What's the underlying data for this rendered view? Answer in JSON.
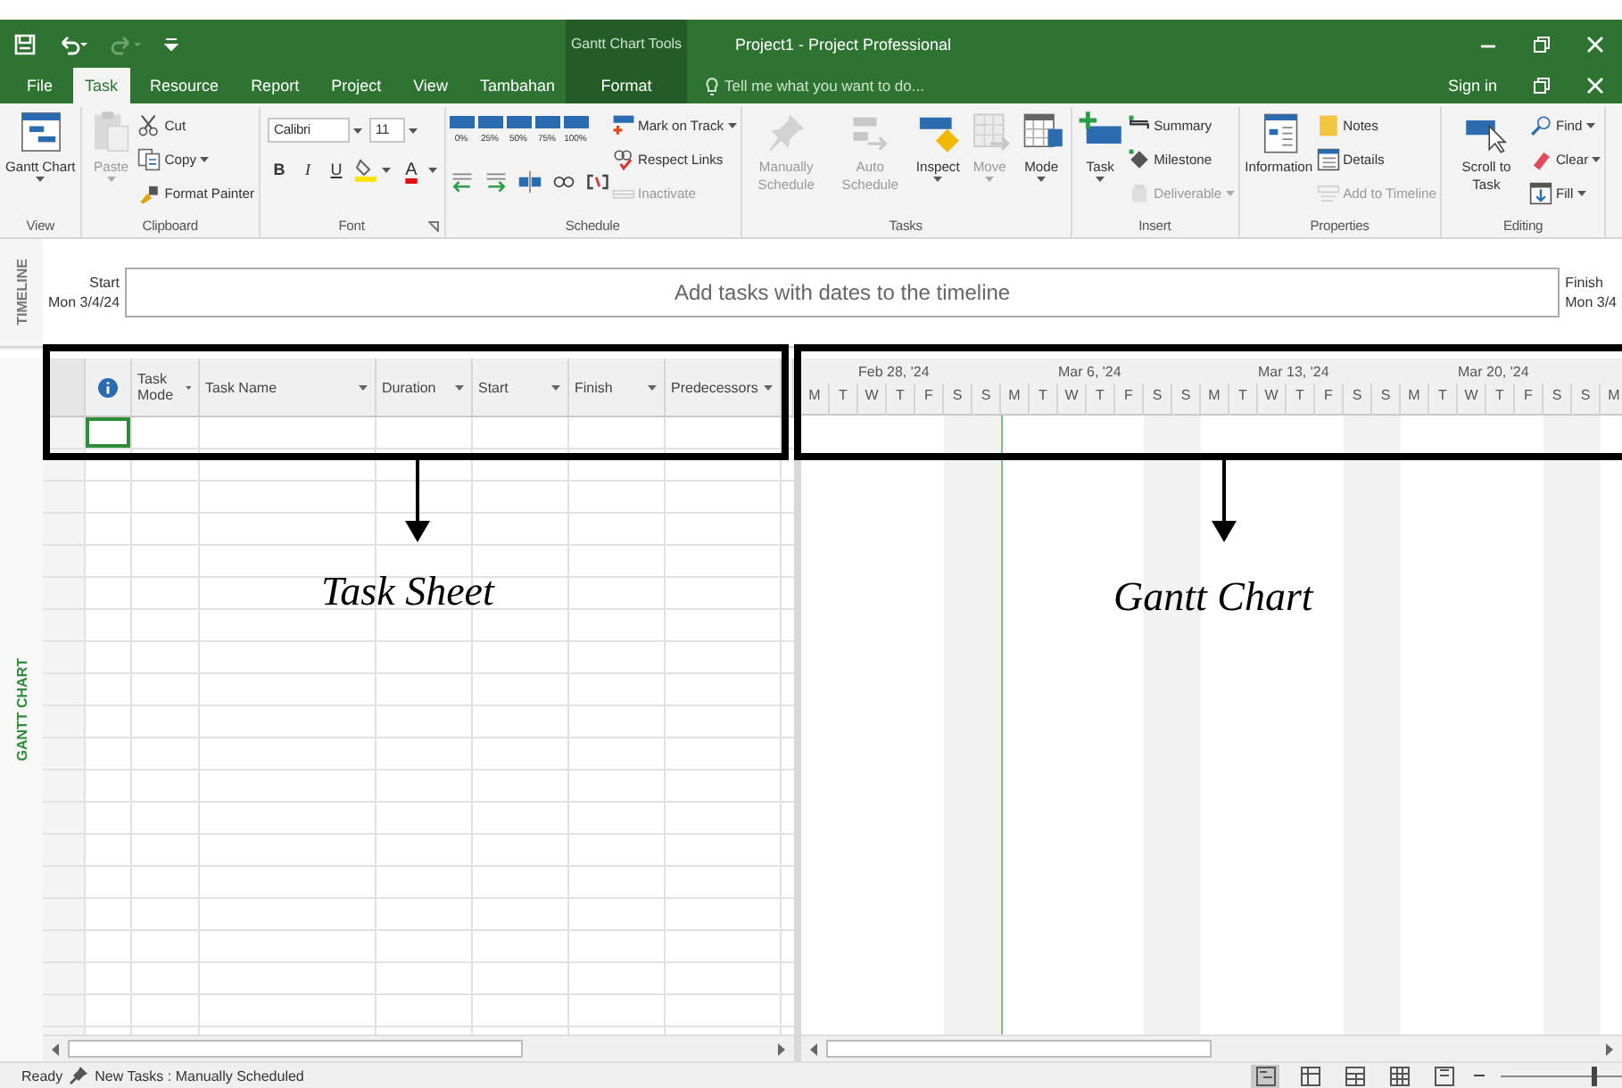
{
  "title_bar": {
    "context_group": "Gantt Chart Tools",
    "title": "Project1 - Project Professional"
  },
  "tabs": [
    {
      "label": "File",
      "selected": false,
      "contextual": false
    },
    {
      "label": "Task",
      "selected": true,
      "contextual": false
    },
    {
      "label": "Resource",
      "selected": false,
      "contextual": false
    },
    {
      "label": "Report",
      "selected": false,
      "contextual": false
    },
    {
      "label": "Project",
      "selected": false,
      "contextual": false
    },
    {
      "label": "View",
      "selected": false,
      "contextual": false
    },
    {
      "label": "Tambahan",
      "selected": false,
      "contextual": false
    },
    {
      "label": "Format",
      "selected": false,
      "contextual": true
    }
  ],
  "tell_me": {
    "placeholder": "Tell me what you want to do..."
  },
  "sign_in": "Sign in",
  "ribbon": [
    {
      "label": "View",
      "items": [
        {
          "kind": "large",
          "label": "Gantt Chart",
          "disabled": false,
          "dropdown": true
        }
      ]
    },
    {
      "label": "Clipboard",
      "items": [
        {
          "kind": "large",
          "label": "Paste",
          "disabled": true,
          "dropdown": true
        },
        {
          "kind": "small",
          "label": "Cut",
          "disabled": false,
          "dropdown": false
        },
        {
          "kind": "small",
          "label": "Copy",
          "disabled": false,
          "dropdown": true
        },
        {
          "kind": "small",
          "label": "Format Painter",
          "disabled": false,
          "dropdown": false
        }
      ]
    },
    {
      "label": "Font",
      "launcher": true,
      "font": {
        "family": "Calibri",
        "size": "11",
        "styles": [
          "B",
          "I",
          "U"
        ],
        "color_letter": "A"
      }
    },
    {
      "label": "Schedule",
      "percent": [
        "0%",
        "25%",
        "50%",
        "75%",
        "100%"
      ],
      "items": [
        {
          "kind": "small",
          "label": "Mark on Track",
          "disabled": false,
          "dropdown": true
        },
        {
          "kind": "small",
          "label": "Respect Links",
          "disabled": false,
          "dropdown": false
        },
        {
          "kind": "small",
          "label": "Inactivate",
          "disabled": true,
          "dropdown": false
        }
      ]
    },
    {
      "label": "Tasks",
      "items": [
        {
          "kind": "large",
          "label": "Manually Schedule",
          "disabled": true,
          "dropdown": false
        },
        {
          "kind": "large",
          "label": "Auto Schedule",
          "disabled": true,
          "dropdown": false
        },
        {
          "kind": "large",
          "label": "Inspect",
          "disabled": false,
          "dropdown": true
        },
        {
          "kind": "large",
          "label": "Move",
          "disabled": true,
          "dropdown": true
        },
        {
          "kind": "large",
          "label": "Mode",
          "disabled": false,
          "dropdown": true
        }
      ]
    },
    {
      "label": "Insert",
      "items": [
        {
          "kind": "large",
          "label": "Task",
          "disabled": false,
          "dropdown": true
        },
        {
          "kind": "small",
          "label": "Summary",
          "disabled": false,
          "dropdown": false
        },
        {
          "kind": "small",
          "label": "Milestone",
          "disabled": false,
          "dropdown": false
        },
        {
          "kind": "small",
          "label": "Deliverable",
          "disabled": true,
          "dropdown": true
        }
      ]
    },
    {
      "label": "Properties",
      "items": [
        {
          "kind": "large",
          "label": "Information",
          "disabled": false,
          "dropdown": false
        },
        {
          "kind": "small",
          "label": "Notes",
          "disabled": false,
          "dropdown": false
        },
        {
          "kind": "small",
          "label": "Details",
          "disabled": false,
          "dropdown": false
        },
        {
          "kind": "small",
          "label": "Add to Timeline",
          "disabled": true,
          "dropdown": false
        }
      ]
    },
    {
      "label": "Editing",
      "items": [
        {
          "kind": "large",
          "label": "Scroll to Task",
          "disabled": false,
          "dropdown": false
        },
        {
          "kind": "small",
          "label": "Find",
          "disabled": false,
          "dropdown": true
        },
        {
          "kind": "small",
          "label": "Clear",
          "disabled": false,
          "dropdown": true
        },
        {
          "kind": "small",
          "label": "Fill",
          "disabled": false,
          "dropdown": true
        }
      ]
    }
  ],
  "timeline": {
    "side_label": "TIMELINE",
    "start_label": "Start",
    "start_date": "Mon 3/4/24",
    "hint": "Add tasks with dates to the timeline",
    "finish_label": "Finish",
    "finish_date": "Mon 3/4"
  },
  "view_bar_label": "GANTT CHART",
  "task_sheet": {
    "columns": [
      "Task Mode",
      "Task Name",
      "Duration",
      "Start",
      "Finish",
      "Predecessors"
    ]
  },
  "gantt": {
    "weeks": [
      "Feb 28, '24",
      "Mar 6, '24",
      "Mar 13, '24",
      "Mar 20, '24"
    ],
    "days": [
      {
        "letter": "M",
        "weekend": false
      },
      {
        "letter": "T",
        "weekend": false
      },
      {
        "letter": "W",
        "weekend": false
      },
      {
        "letter": "T",
        "weekend": false
      },
      {
        "letter": "F",
        "weekend": false
      },
      {
        "letter": "S",
        "weekend": true
      },
      {
        "letter": "S",
        "weekend": true
      },
      {
        "letter": "M",
        "weekend": false
      },
      {
        "letter": "T",
        "weekend": false
      },
      {
        "letter": "W",
        "weekend": false
      },
      {
        "letter": "T",
        "weekend": false
      },
      {
        "letter": "F",
        "weekend": false
      },
      {
        "letter": "S",
        "weekend": true
      },
      {
        "letter": "S",
        "weekend": true
      },
      {
        "letter": "M",
        "weekend": false
      },
      {
        "letter": "T",
        "weekend": false
      },
      {
        "letter": "W",
        "weekend": false
      },
      {
        "letter": "T",
        "weekend": false
      },
      {
        "letter": "F",
        "weekend": false
      },
      {
        "letter": "S",
        "weekend": true
      },
      {
        "letter": "S",
        "weekend": true
      },
      {
        "letter": "M",
        "weekend": false
      },
      {
        "letter": "T",
        "weekend": false
      },
      {
        "letter": "W",
        "weekend": false
      },
      {
        "letter": "T",
        "weekend": false
      },
      {
        "letter": "F",
        "weekend": false
      },
      {
        "letter": "S",
        "weekend": true
      },
      {
        "letter": "S",
        "weekend": true
      },
      {
        "letter": "M",
        "weekend": false
      }
    ]
  },
  "annotations": [
    "Task Sheet",
    "Gantt Chart"
  ],
  "status_bar": {
    "ready": "Ready",
    "new_tasks": "New Tasks : Manually Scheduled",
    "views": [
      {
        "selected": true
      },
      {
        "selected": false
      },
      {
        "selected": false
      },
      {
        "selected": false
      },
      {
        "selected": false
      }
    ],
    "zoom": {
      "level": 0.75
    }
  }
}
